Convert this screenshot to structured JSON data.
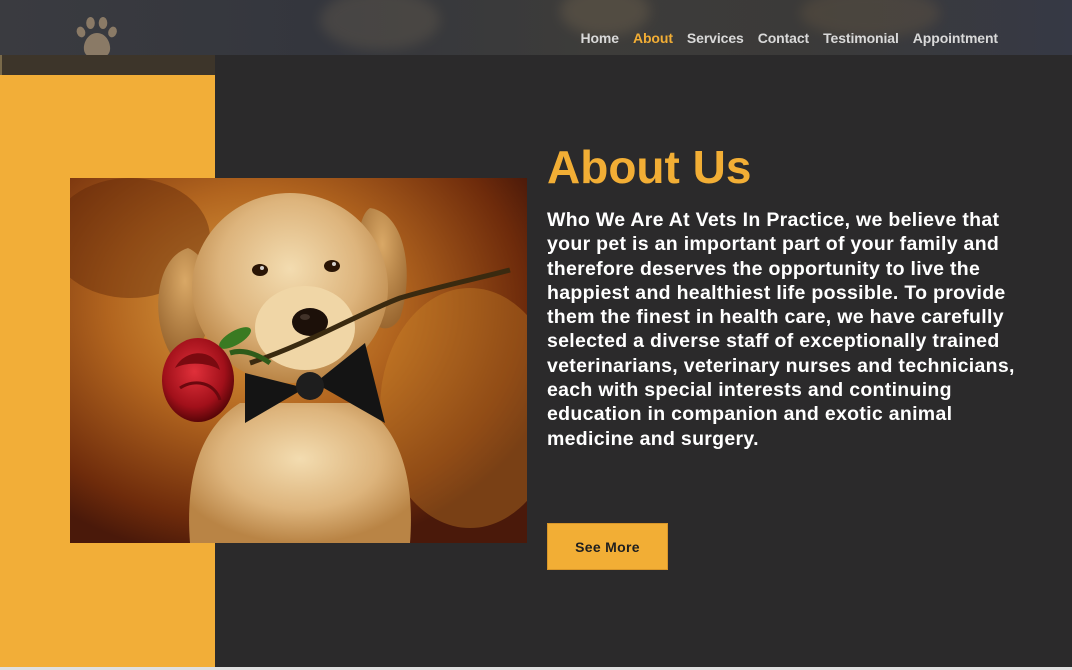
{
  "header": {
    "logo_icon": "paw-icon",
    "nav": [
      {
        "label": "Home",
        "active": false
      },
      {
        "label": "About",
        "active": true
      },
      {
        "label": "Services",
        "active": false
      },
      {
        "label": "Contact",
        "active": false
      },
      {
        "label": "Testimonial",
        "active": false
      },
      {
        "label": "Appointment",
        "active": false
      }
    ]
  },
  "about": {
    "title": "About Us",
    "body": "Who We Are At Vets In Practice, we believe that your pet is an important part of your family and therefore deserves the opportunity to live the happiest and healthiest life possible. To provide them the finest in health care, we have carefully selected a diverse staff of exceptionally trained veterinarians, veterinary nurses and technicians, each with special interests and continuing education in companion and exotic animal medicine and surgery.",
    "button_label": "See More",
    "image_subject": "golden-retriever-puppy-with-rose"
  },
  "colors": {
    "accent": "#f2ae35",
    "background": "#2b2a2b",
    "text": "#ffffff"
  }
}
